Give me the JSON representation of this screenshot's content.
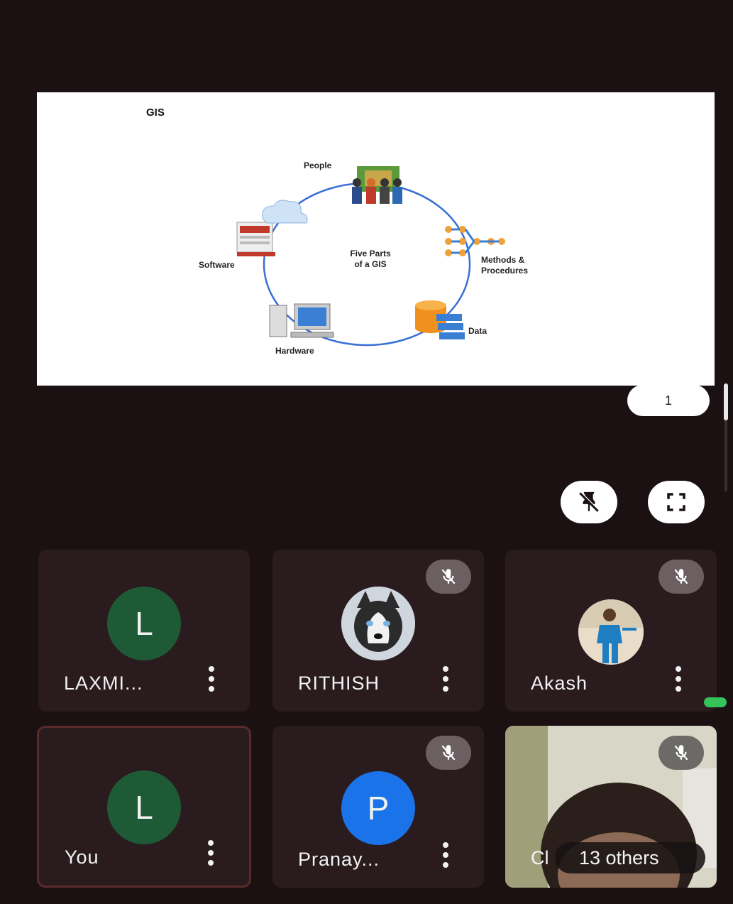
{
  "slide": {
    "title": "GIS",
    "center_label": "Five Parts\nof a GIS",
    "parts": {
      "people": "People",
      "methods": "Methods &\nProcedures",
      "data": "Data",
      "hardware": "Hardware",
      "software": "Software"
    }
  },
  "page_indicator": "1",
  "controls": {
    "unpin_icon": "unpin-icon",
    "fullscreen_icon": "fullscreen-icon"
  },
  "participants": [
    {
      "name": "LAXMI...",
      "avatar_letter": "L",
      "avatar_color": "#1f5a37",
      "muted": false
    },
    {
      "name": "RITHISH",
      "avatar_type": "photo-husky",
      "muted": true
    },
    {
      "name": "Akash",
      "avatar_type": "photo-person",
      "muted": true
    },
    {
      "name": "You",
      "avatar_letter": "L",
      "avatar_color": "#1f5a37",
      "muted": false,
      "self": true
    },
    {
      "name": "Pranay...",
      "avatar_letter": "P",
      "avatar_color": "#1a73e8",
      "muted": true
    },
    {
      "name_prefix": "Cl",
      "others_label": "13 others",
      "avatar_type": "video",
      "muted": true
    }
  ],
  "colors": {
    "background": "#1b1112",
    "tile": "#2a1c1e",
    "active_indicator": "#34c35a"
  }
}
